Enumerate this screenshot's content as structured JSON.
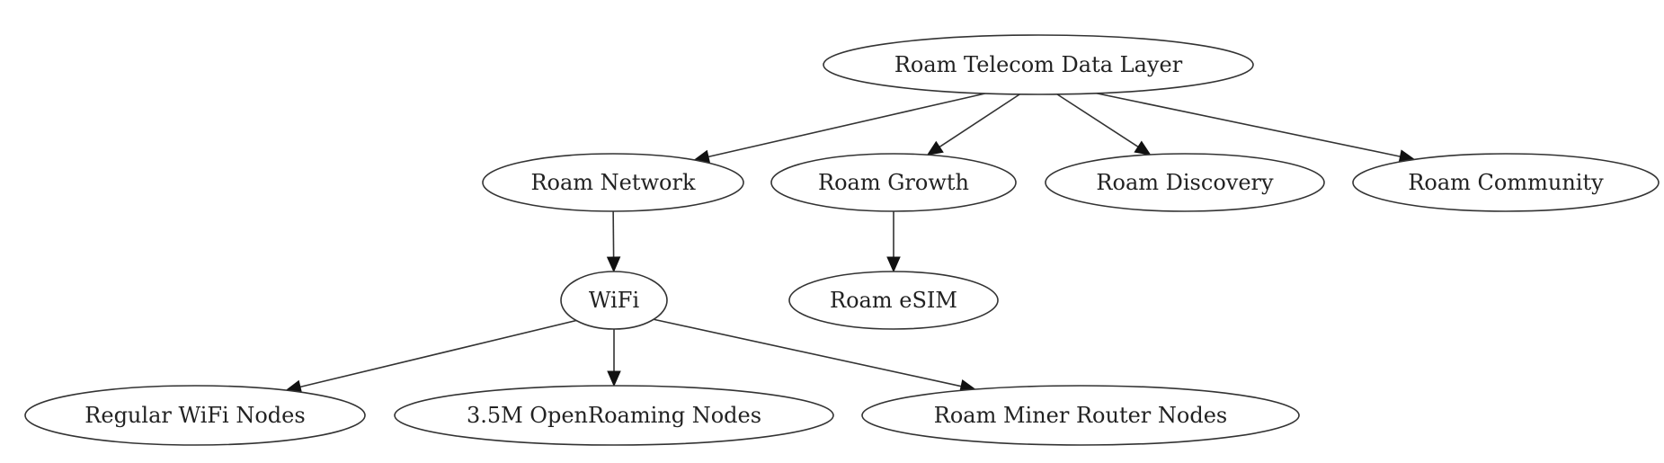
{
  "diagram": {
    "type": "directed-tree",
    "nodes": [
      {
        "id": "root",
        "label": "Roam Telecom Data Layer"
      },
      {
        "id": "network",
        "label": "Roam Network"
      },
      {
        "id": "growth",
        "label": "Roam Growth"
      },
      {
        "id": "discovery",
        "label": "Roam Discovery"
      },
      {
        "id": "community",
        "label": "Roam Community"
      },
      {
        "id": "wifi",
        "label": "WiFi"
      },
      {
        "id": "esim",
        "label": "Roam eSIM"
      },
      {
        "id": "regular",
        "label": "Regular WiFi Nodes"
      },
      {
        "id": "openroaming",
        "label": "3.5M OpenRoaming Nodes"
      },
      {
        "id": "miner",
        "label": "Roam Miner Router Nodes"
      }
    ],
    "edges": [
      {
        "from": "root",
        "to": "network"
      },
      {
        "from": "root",
        "to": "growth"
      },
      {
        "from": "root",
        "to": "discovery"
      },
      {
        "from": "root",
        "to": "community"
      },
      {
        "from": "network",
        "to": "wifi"
      },
      {
        "from": "growth",
        "to": "esim"
      },
      {
        "from": "wifi",
        "to": "regular"
      },
      {
        "from": "wifi",
        "to": "openroaming"
      },
      {
        "from": "wifi",
        "to": "miner"
      }
    ]
  }
}
